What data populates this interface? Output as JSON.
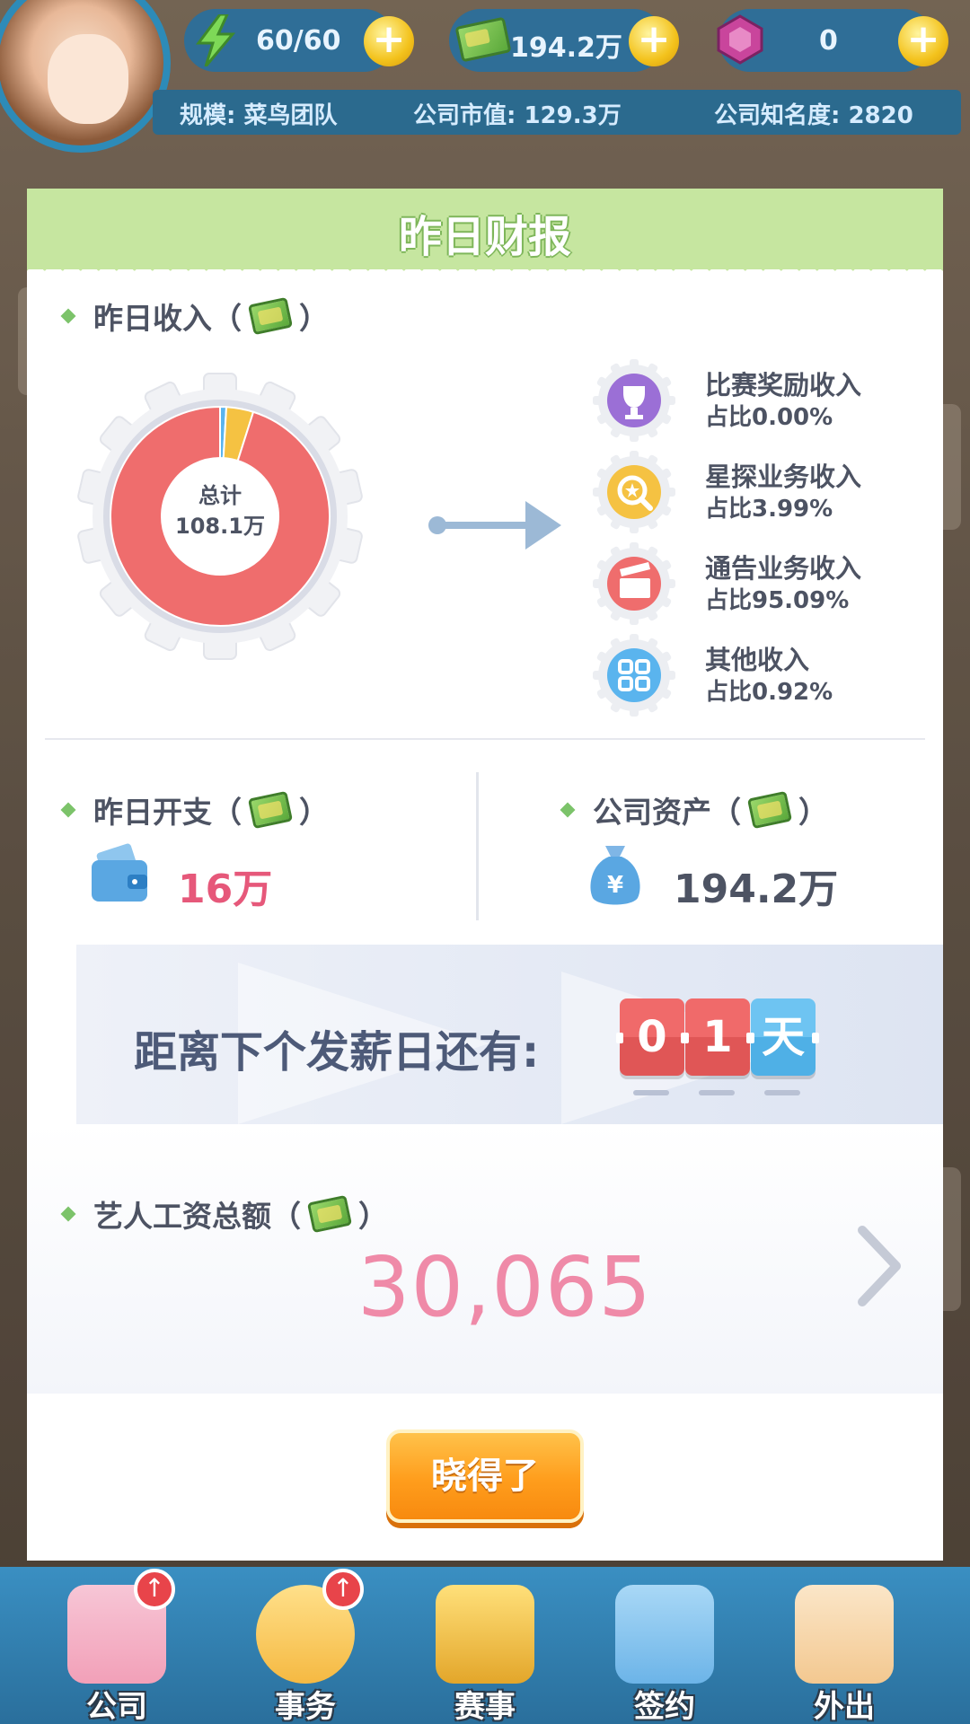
{
  "topbar": {
    "energy": "60/60",
    "cash": "194.2万",
    "gems": "0",
    "scale": "规模: 菜鸟团队",
    "market_value": "公司市值: 129.3万",
    "fame": "公司知名度: 2820"
  },
  "dialog": {
    "title": "昨日财报",
    "income": {
      "label": "昨日收入（",
      "label_close": "）",
      "total_label": "总计",
      "total_value": "108.1万",
      "items": [
        {
          "name": "比赛奖励收入",
          "share": "占比0.00%",
          "icon": "trophy-icon",
          "color": "#9b6fd6"
        },
        {
          "name": "星探业务收入",
          "share": "占比3.99%",
          "icon": "search-star-icon",
          "color": "#f5c242"
        },
        {
          "name": "通告业务收入",
          "share": "占比95.09%",
          "icon": "clapper-icon",
          "color": "#ef6d6d"
        },
        {
          "name": "其他收入",
          "share": "占比0.92%",
          "icon": "grid-icon",
          "color": "#5ab4ee"
        }
      ]
    },
    "expense": {
      "label": "昨日开支（",
      "label_close": "）",
      "value": "16万"
    },
    "assets": {
      "label": "公司资产（",
      "label_close": "）",
      "value": "194.2万"
    },
    "payday": {
      "text": "距离下个发薪日还有:",
      "d1": "0",
      "d2": "1",
      "unit": "天"
    },
    "salary": {
      "label": "艺人工资总额（",
      "label_close": "）",
      "value": "30,065"
    },
    "ok_button": "晓得了"
  },
  "nav": [
    {
      "label": "公司"
    },
    {
      "label": "事务"
    },
    {
      "label": "赛事"
    },
    {
      "label": "签约"
    },
    {
      "label": "外出"
    }
  ],
  "chart_data": {
    "type": "pie",
    "categories": [
      "比赛奖励收入",
      "星探业务收入",
      "通告业务收入",
      "其他收入"
    ],
    "values": [
      0.0,
      3.99,
      95.09,
      0.92
    ],
    "colors": [
      "#9b6fd6",
      "#f5c242",
      "#ef6d6d",
      "#5ab4ee"
    ]
  }
}
